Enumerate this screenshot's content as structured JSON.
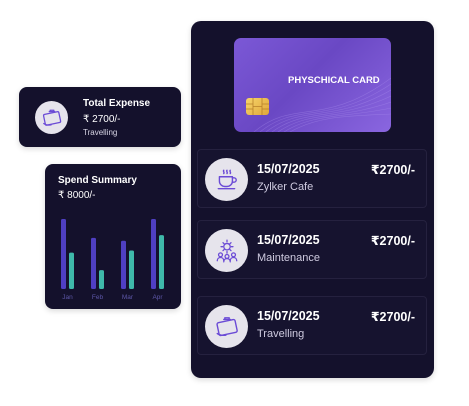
{
  "expense_card": {
    "title": "Total Expense",
    "amount": "₹ 2700/-",
    "category": "Travelling",
    "icon": "travel-bag-icon"
  },
  "spend_summary": {
    "title": "Spend Summary",
    "amount": "₹ 8000/-",
    "colors": {
      "series_a": "#4f3fc2",
      "series_b": "#3fb9aa",
      "axis_label": "#5d57a8"
    }
  },
  "chart_data": {
    "type": "bar",
    "categories": [
      "Jan",
      "Feb",
      "Mar",
      "Apr"
    ],
    "series": [
      {
        "values": [
          100,
          73,
          69,
          100
        ]
      },
      {
        "values": [
          52,
          27,
          55,
          77
        ]
      }
    ],
    "ylim": [
      0,
      100
    ],
    "grid": false
  },
  "physical_card": {
    "label": "PHYSCHICAL CARD",
    "chip": "chip-icon",
    "colors": {
      "card": "#7350d0"
    }
  },
  "transactions": [
    {
      "date": "15/07/2025",
      "name": "Zylker Cafe",
      "amount": "₹2700/-",
      "icon": "coffee-cup-icon"
    },
    {
      "date": "15/07/2025",
      "name": "Maintenance",
      "amount": "₹2700/-",
      "icon": "team-gear-icon"
    },
    {
      "date": "15/07/2025",
      "name": "Travelling",
      "amount": "₹2700/-",
      "icon": "travel-bag-icon"
    }
  ],
  "accent_color": "#6b4bd6"
}
